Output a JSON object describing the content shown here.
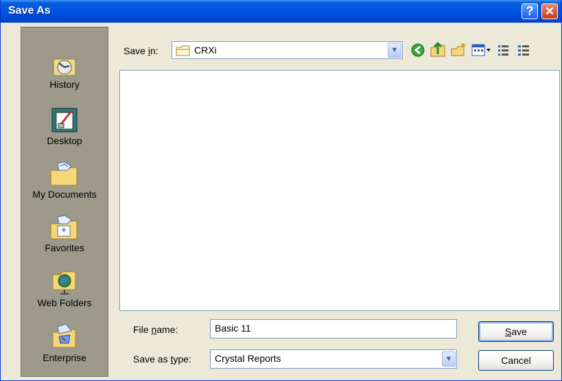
{
  "window": {
    "title": "Save As",
    "help_glyph": "?",
    "close_glyph": "✕"
  },
  "places": [
    {
      "label": "History",
      "icon": "history-icon"
    },
    {
      "label": "Desktop",
      "icon": "desktop-icon"
    },
    {
      "label": "My Documents",
      "icon": "my-documents-icon"
    },
    {
      "label": "Favorites",
      "icon": "favorites-icon"
    },
    {
      "label": "Web Folders",
      "icon": "web-folders-icon"
    },
    {
      "label": "Enterprise",
      "icon": "enterprise-icon"
    }
  ],
  "save_in": {
    "label_pre": "Save ",
    "label_u": "i",
    "label_post": "n:",
    "value": "CRXi",
    "arrow": "▼"
  },
  "file_name": {
    "label_pre": "File ",
    "label_u": "n",
    "label_post": "ame:",
    "value": "Basic 11"
  },
  "save_as_type": {
    "label_pre": "Save as ",
    "label_u": "t",
    "label_post": "ype:",
    "value": "Crystal Reports",
    "arrow": "▼"
  },
  "buttons": {
    "save_u": "S",
    "save_rest": "ave",
    "cancel": "Cancel"
  },
  "colors": {
    "titlebar": "#0055e5",
    "places_bg": "#9d9a8c",
    "dialog_bg": "#ece9d8"
  }
}
